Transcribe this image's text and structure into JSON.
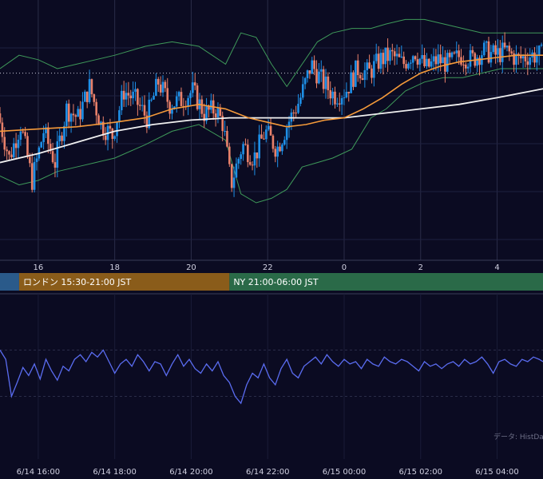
{
  "colors": {
    "background": "#0b0b22",
    "grid": "#2a2c48",
    "candle_up": "#1e90e8",
    "candle_down": "#e8806a",
    "ma_short": "#f59a3a",
    "ma_long": "#f0f0f0",
    "bollinger": "#3f9a5a",
    "oscillator": "#5a6cf0",
    "session_tokyo": "#2a5a8a",
    "session_london": "#8a5c1a",
    "session_ny": "#2a6a48"
  },
  "sessions": [
    {
      "label": "",
      "start": 13.5,
      "end": 15.5,
      "color": "#2a5a8a"
    },
    {
      "label": "ロンドン 15:30-21:00 JST",
      "start": 15.5,
      "end": 21.0,
      "color": "#8a5c1a"
    },
    {
      "label": "NY 21:00-06:00 JST",
      "start": 21.0,
      "end": 30.0,
      "color": "#2a6a48"
    }
  ],
  "attribution": "データ: HistData",
  "chart_data": [
    {
      "type": "candlestick",
      "title": "",
      "x_unit": "hour (JST, 24 = 6/15 00:00)",
      "x_range": [
        15.0,
        29.2
      ],
      "price_range": [
        0.0,
        100.0
      ],
      "x_ticks": [
        {
          "x": 16,
          "label": "16"
        },
        {
          "x": 18,
          "label": "18"
        },
        {
          "x": 20,
          "label": "20"
        },
        {
          "x": 22,
          "label": "22"
        },
        {
          "x": 24,
          "label": "0"
        },
        {
          "x": 26,
          "label": "2"
        },
        {
          "x": 28,
          "label": "4"
        }
      ],
      "reference_line": {
        "value": 78,
        "style": "dotted"
      },
      "series": [
        {
          "name": "",
          "kind": "price_path",
          "points": [
            [
              15.0,
              60
            ],
            [
              15.3,
              40
            ],
            [
              15.6,
              55
            ],
            [
              15.9,
              30
            ],
            [
              16.2,
              52
            ],
            [
              16.5,
              38
            ],
            [
              16.8,
              62
            ],
            [
              17.1,
              58
            ],
            [
              17.4,
              72
            ],
            [
              17.7,
              55
            ],
            [
              18.0,
              50
            ],
            [
              18.3,
              70
            ],
            [
              18.6,
              66
            ],
            [
              18.9,
              58
            ],
            [
              19.2,
              74
            ],
            [
              19.5,
              64
            ],
            [
              19.8,
              66
            ],
            [
              20.1,
              70
            ],
            [
              20.4,
              60
            ],
            [
              20.7,
              62
            ],
            [
              20.9,
              55
            ],
            [
              21.1,
              28
            ],
            [
              21.4,
              46
            ],
            [
              21.7,
              40
            ],
            [
              22.0,
              52
            ],
            [
              22.3,
              44
            ],
            [
              22.6,
              56
            ],
            [
              22.9,
              66
            ],
            [
              23.2,
              82
            ],
            [
              23.5,
              74
            ],
            [
              23.8,
              68
            ],
            [
              24.1,
              70
            ],
            [
              24.4,
              80
            ],
            [
              24.7,
              78
            ],
            [
              25.0,
              84
            ],
            [
              25.3,
              86
            ],
            [
              25.6,
              82
            ],
            [
              25.9,
              88
            ],
            [
              26.2,
              80
            ],
            [
              26.5,
              84
            ],
            [
              26.8,
              82
            ],
            [
              27.1,
              86
            ],
            [
              27.4,
              84
            ],
            [
              27.7,
              88
            ],
            [
              28.0,
              86
            ],
            [
              28.3,
              88
            ],
            [
              28.6,
              84
            ],
            [
              28.9,
              86
            ],
            [
              29.2,
              86
            ]
          ]
        },
        {
          "name": "",
          "kind": "ma_short",
          "points": [
            [
              15.0,
              52
            ],
            [
              16.0,
              53
            ],
            [
              17.0,
              54
            ],
            [
              18.0,
              56
            ],
            [
              18.8,
              58
            ],
            [
              19.5,
              62
            ],
            [
              20.2,
              64
            ],
            [
              20.9,
              62
            ],
            [
              21.5,
              58
            ],
            [
              22.0,
              56
            ],
            [
              22.5,
              54
            ],
            [
              23.0,
              55
            ],
            [
              23.5,
              57
            ],
            [
              24.0,
              58
            ],
            [
              24.5,
              62
            ],
            [
              25.0,
              67
            ],
            [
              25.5,
              73
            ],
            [
              26.0,
              78
            ],
            [
              26.5,
              81
            ],
            [
              27.0,
              83
            ],
            [
              27.5,
              84
            ],
            [
              28.0,
              85
            ],
            [
              28.5,
              86
            ],
            [
              29.2,
              86
            ]
          ]
        },
        {
          "name": "",
          "kind": "ma_long",
          "points": [
            [
              15.0,
              38
            ],
            [
              16.0,
              42
            ],
            [
              17.0,
              47
            ],
            [
              18.0,
              52
            ],
            [
              19.0,
              55
            ],
            [
              20.0,
              57
            ],
            [
              21.0,
              58
            ],
            [
              22.0,
              58
            ],
            [
              23.0,
              58
            ],
            [
              24.0,
              58
            ],
            [
              25.0,
              60
            ],
            [
              26.0,
              62
            ],
            [
              27.0,
              64
            ],
            [
              28.0,
              67
            ],
            [
              29.2,
              71
            ]
          ]
        },
        {
          "name": "",
          "kind": "band_upper",
          "points": [
            [
              15.0,
              80
            ],
            [
              15.5,
              86
            ],
            [
              16.0,
              84
            ],
            [
              16.5,
              80
            ],
            [
              17.0,
              82
            ],
            [
              17.5,
              84
            ],
            [
              18.0,
              86
            ],
            [
              18.8,
              90
            ],
            [
              19.5,
              92
            ],
            [
              20.2,
              90
            ],
            [
              20.9,
              82
            ],
            [
              21.3,
              96
            ],
            [
              21.7,
              94
            ],
            [
              22.1,
              82
            ],
            [
              22.5,
              72
            ],
            [
              22.9,
              82
            ],
            [
              23.3,
              92
            ],
            [
              23.7,
              96
            ],
            [
              24.2,
              98
            ],
            [
              24.7,
              98
            ],
            [
              25.1,
              100
            ],
            [
              25.6,
              102
            ],
            [
              26.1,
              102
            ],
            [
              26.6,
              100
            ],
            [
              27.1,
              98
            ],
            [
              27.6,
              96
            ],
            [
              28.1,
              96
            ],
            [
              28.6,
              96
            ],
            [
              29.2,
              96
            ]
          ]
        },
        {
          "name": "",
          "kind": "band_lower",
          "points": [
            [
              15.0,
              32
            ],
            [
              15.5,
              28
            ],
            [
              16.0,
              30
            ],
            [
              16.5,
              34
            ],
            [
              17.0,
              36
            ],
            [
              17.5,
              38
            ],
            [
              18.0,
              40
            ],
            [
              18.8,
              46
            ],
            [
              19.5,
              52
            ],
            [
              20.2,
              55
            ],
            [
              20.9,
              48
            ],
            [
              21.3,
              24
            ],
            [
              21.7,
              20
            ],
            [
              22.1,
              22
            ],
            [
              22.5,
              26
            ],
            [
              22.9,
              36
            ],
            [
              23.3,
              38
            ],
            [
              23.7,
              40
            ],
            [
              24.2,
              44
            ],
            [
              24.7,
              58
            ],
            [
              25.1,
              62
            ],
            [
              25.6,
              70
            ],
            [
              26.1,
              74
            ],
            [
              26.6,
              76
            ],
            [
              27.1,
              76
            ],
            [
              27.6,
              78
            ],
            [
              28.1,
              80
            ],
            [
              28.6,
              80
            ],
            [
              29.2,
              80
            ]
          ]
        }
      ]
    },
    {
      "type": "line",
      "title": "",
      "x_unit": "hour (JST)",
      "x_range": [
        15.0,
        29.2
      ],
      "y_range": [
        0,
        100
      ],
      "x_ticks": [
        {
          "x": 16,
          "label": "6/14 16:00"
        },
        {
          "x": 18,
          "label": "6/14 18:00"
        },
        {
          "x": 20,
          "label": "6/14 20:00"
        },
        {
          "x": 22,
          "label": "6/14 22:00"
        },
        {
          "x": 24,
          "label": "6/15 00:00"
        },
        {
          "x": 26,
          "label": "6/15 02:00"
        },
        {
          "x": 28,
          "label": "6/15 04:00"
        }
      ],
      "gridlines": [
        70,
        30
      ],
      "series": [
        {
          "name": "",
          "points": [
            [
              15.0,
              70
            ],
            [
              15.15,
              62
            ],
            [
              15.3,
              30
            ],
            [
              15.45,
              42
            ],
            [
              15.6,
              55
            ],
            [
              15.75,
              48
            ],
            [
              15.9,
              58
            ],
            [
              16.05,
              45
            ],
            [
              16.2,
              62
            ],
            [
              16.35,
              52
            ],
            [
              16.5,
              44
            ],
            [
              16.65,
              56
            ],
            [
              16.8,
              52
            ],
            [
              16.95,
              62
            ],
            [
              17.1,
              66
            ],
            [
              17.25,
              60
            ],
            [
              17.4,
              68
            ],
            [
              17.55,
              64
            ],
            [
              17.7,
              70
            ],
            [
              17.85,
              60
            ],
            [
              18.0,
              50
            ],
            [
              18.15,
              58
            ],
            [
              18.3,
              62
            ],
            [
              18.45,
              56
            ],
            [
              18.6,
              66
            ],
            [
              18.75,
              60
            ],
            [
              18.9,
              52
            ],
            [
              19.05,
              60
            ],
            [
              19.2,
              58
            ],
            [
              19.35,
              48
            ],
            [
              19.5,
              58
            ],
            [
              19.65,
              66
            ],
            [
              19.8,
              56
            ],
            [
              19.95,
              62
            ],
            [
              20.1,
              54
            ],
            [
              20.25,
              50
            ],
            [
              20.4,
              58
            ],
            [
              20.55,
              52
            ],
            [
              20.7,
              60
            ],
            [
              20.85,
              48
            ],
            [
              21.0,
              42
            ],
            [
              21.15,
              30
            ],
            [
              21.3,
              24
            ],
            [
              21.45,
              40
            ],
            [
              21.6,
              50
            ],
            [
              21.75,
              46
            ],
            [
              21.9,
              58
            ],
            [
              22.05,
              46
            ],
            [
              22.2,
              40
            ],
            [
              22.35,
              54
            ],
            [
              22.5,
              62
            ],
            [
              22.65,
              50
            ],
            [
              22.8,
              46
            ],
            [
              22.95,
              56
            ],
            [
              23.1,
              60
            ],
            [
              23.25,
              64
            ],
            [
              23.4,
              58
            ],
            [
              23.55,
              66
            ],
            [
              23.7,
              60
            ],
            [
              23.85,
              56
            ],
            [
              24.0,
              62
            ],
            [
              24.15,
              58
            ],
            [
              24.3,
              60
            ],
            [
              24.45,
              54
            ],
            [
              24.6,
              62
            ],
            [
              24.75,
              58
            ],
            [
              24.9,
              56
            ],
            [
              25.05,
              64
            ],
            [
              25.2,
              60
            ],
            [
              25.35,
              58
            ],
            [
              25.5,
              62
            ],
            [
              25.65,
              60
            ],
            [
              25.8,
              56
            ],
            [
              25.95,
              52
            ],
            [
              26.1,
              60
            ],
            [
              26.25,
              56
            ],
            [
              26.4,
              58
            ],
            [
              26.55,
              54
            ],
            [
              26.7,
              58
            ],
            [
              26.85,
              60
            ],
            [
              27.0,
              56
            ],
            [
              27.15,
              62
            ],
            [
              27.3,
              58
            ],
            [
              27.45,
              60
            ],
            [
              27.6,
              64
            ],
            [
              27.75,
              58
            ],
            [
              27.9,
              50
            ],
            [
              28.05,
              60
            ],
            [
              28.2,
              62
            ],
            [
              28.35,
              58
            ],
            [
              28.5,
              56
            ],
            [
              28.65,
              62
            ],
            [
              28.8,
              60
            ],
            [
              28.95,
              64
            ],
            [
              29.1,
              62
            ],
            [
              29.2,
              60
            ]
          ]
        }
      ]
    }
  ]
}
